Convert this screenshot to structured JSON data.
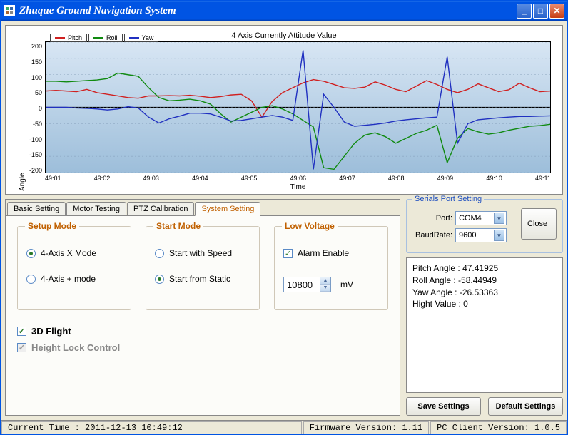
{
  "window": {
    "title": "Zhuque Ground Navigation System"
  },
  "chart_data": {
    "type": "line",
    "title": "4 Axis Currently Attitude Value",
    "xlabel": "Time",
    "ylabel": "Angle",
    "ylim": [
      -200,
      200
    ],
    "yticks": [
      200,
      150,
      100,
      50,
      0,
      -50,
      -100,
      -150,
      -200
    ],
    "xticks": [
      "49:01",
      "49:02",
      "49:03",
      "49:04",
      "49:05",
      "49:06",
      "49:07",
      "49:08",
      "49:09",
      "49:10",
      "49:11"
    ],
    "series": [
      {
        "name": "Pitch",
        "color": "#d02020",
        "values": [
          50,
          52,
          50,
          48,
          55,
          45,
          40,
          35,
          30,
          28,
          35,
          35,
          36,
          35,
          37,
          34,
          30,
          33,
          38,
          40,
          20,
          -30,
          18,
          45,
          60,
          75,
          85,
          80,
          70,
          60,
          58,
          62,
          78,
          68,
          55,
          48,
          65,
          82,
          70,
          55,
          45,
          55,
          72,
          60,
          48,
          54,
          74,
          60,
          48,
          50
        ]
      },
      {
        "name": "Roll",
        "color": "#108a10",
        "values": [
          80,
          80,
          78,
          80,
          82,
          84,
          88,
          105,
          100,
          95,
          60,
          30,
          20,
          22,
          25,
          20,
          10,
          -20,
          -45,
          -30,
          -15,
          0,
          5,
          -5,
          -20,
          -40,
          -60,
          -185,
          -190,
          -150,
          -110,
          -85,
          -78,
          -90,
          -110,
          -95,
          -80,
          -70,
          -55,
          -170,
          -95,
          -65,
          -75,
          -82,
          -78,
          -70,
          -64,
          -58,
          -56,
          -52
        ]
      },
      {
        "name": "Yaw",
        "color": "#2030c0",
        "values": [
          0,
          0,
          0,
          -2,
          -3,
          -5,
          -8,
          -5,
          2,
          -2,
          -30,
          -48,
          -35,
          -27,
          -18,
          -18,
          -20,
          -30,
          -42,
          -40,
          -35,
          -30,
          -25,
          -30,
          -40,
          175,
          -190,
          40,
          0,
          -45,
          -58,
          -55,
          -52,
          -48,
          -42,
          -38,
          -35,
          -32,
          -30,
          155,
          -110,
          -50,
          -38,
          -35,
          -32,
          -30,
          -28,
          -28,
          -27,
          -26
        ]
      }
    ]
  },
  "tabs": {
    "items": [
      "Basic Setting",
      "Motor Testing",
      "PTZ Calibration",
      "System Setting"
    ],
    "active": 3
  },
  "setup_mode": {
    "title": "Setup Mode",
    "opt1": "4-Axis X Mode",
    "opt2": "4-Axis + mode",
    "selected": 0
  },
  "start_mode": {
    "title": "Start Mode",
    "opt1": "Start with Speed",
    "opt2": "Start from Static",
    "selected": 1
  },
  "low_voltage": {
    "title": "Low Voltage",
    "alarm_label": "Alarm Enable",
    "alarm_checked": true,
    "value": "10800",
    "unit": "mV"
  },
  "checks": {
    "flight3d_label": "3D Flight",
    "flight3d_checked": true,
    "heightlock_label": "Height Lock Control",
    "heightlock_checked": true
  },
  "serial": {
    "title": "Serials Port Setting",
    "port_label": "Port:",
    "port_value": "COM4",
    "baud_label": "BaudRate:",
    "baud_value": "9600",
    "close_btn": "Close"
  },
  "telemetry": {
    "pitch_label": "Pitch Angle :",
    "pitch_value": "47.41925",
    "roll_label": "Roll Angle :",
    "roll_value": "-58.44949",
    "yaw_label": "Yaw Angle :",
    "yaw_value": "-26.53363",
    "height_label": "Hight Value :",
    "height_value": "0"
  },
  "buttons": {
    "save": "Save Settings",
    "defaults": "Default Settings"
  },
  "status": {
    "time_label": "Current Time :",
    "time_value": "2011-12-13 10:49:12",
    "fw_label": "Firmware Version:",
    "fw_value": "1.11",
    "pc_label": "PC Client Version:",
    "pc_value": "1.0.5"
  }
}
